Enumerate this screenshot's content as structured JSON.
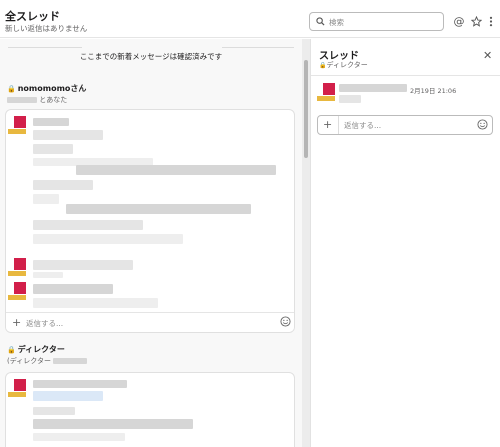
{
  "header": {
    "title": "全スレッド",
    "subtitle": "新しい返信はありません",
    "search_placeholder": "検索"
  },
  "feed": {
    "notice": "ここまでの新着メッセージは確認済みです",
    "conversations": [
      {
        "name": "nomomomoさん",
        "subtitle": "とあなた",
        "reply_placeholder": "返信する..."
      },
      {
        "name": "ディレクター",
        "subtitle": "(ディレクター"
      }
    ]
  },
  "thread_panel": {
    "title": "スレッド",
    "channel": "ディレクター",
    "timestamp": "2月19日 21:06",
    "reply_placeholder": "返信する..."
  },
  "colors": {
    "avatar_red": "#d21f4a",
    "avatar_yellow": "#e8b83f"
  },
  "icons": [
    "search-icon",
    "mention-icon",
    "star-icon",
    "more-icon",
    "lock-icon",
    "close-icon",
    "plus-icon",
    "emoji-icon"
  ]
}
